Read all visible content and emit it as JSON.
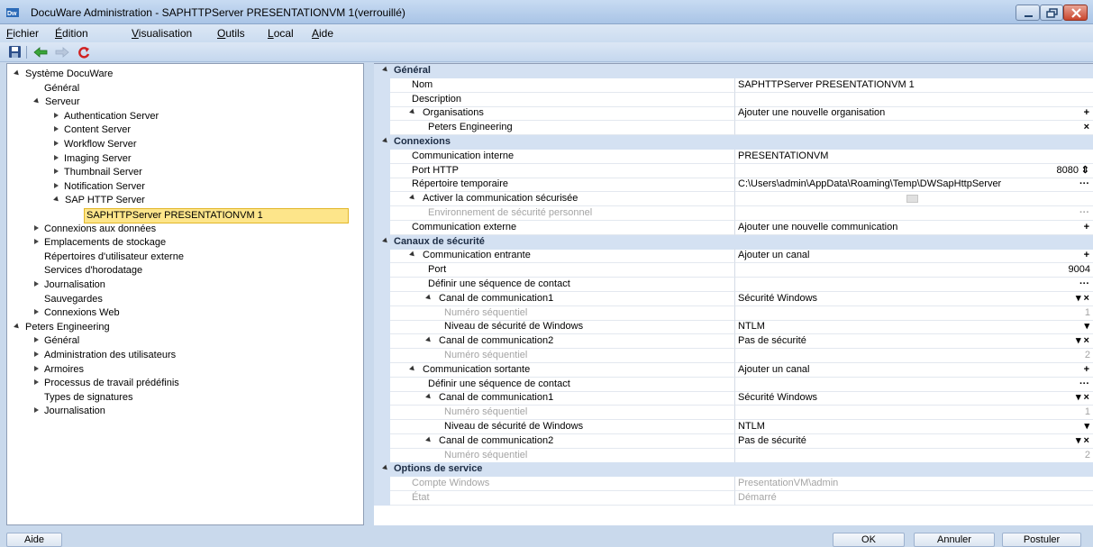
{
  "window": {
    "title": "DocuWare Administration - SAPHTTPServer PRESENTATIONVM 1(verrouillé)",
    "app_icon": "docuware-icon"
  },
  "menu": [
    {
      "accel": "F",
      "rest": "ichier"
    },
    {
      "accel": "É",
      "rest": "dition"
    },
    {
      "accel": "V",
      "rest": "isualisation"
    },
    {
      "accel": "O",
      "rest": "utils"
    },
    {
      "accel": "L",
      "rest": "ocal"
    },
    {
      "accel": "A",
      "rest": "ide"
    }
  ],
  "toolbar": [
    "save-icon",
    "back-arrow-icon",
    "forward-arrow-icon",
    "refresh-icon"
  ],
  "tree": [
    {
      "label": "Système DocuWare",
      "level": 0,
      "state": "open"
    },
    {
      "label": "Général",
      "level": 1,
      "state": "none"
    },
    {
      "label": "Serveur",
      "level": 1,
      "state": "open"
    },
    {
      "label": "Authentication Server",
      "level": 2,
      "state": "closed"
    },
    {
      "label": "Content Server",
      "level": 2,
      "state": "closed"
    },
    {
      "label": "Workflow Server",
      "level": 2,
      "state": "closed"
    },
    {
      "label": "Imaging Server",
      "level": 2,
      "state": "closed"
    },
    {
      "label": "Thumbnail Server",
      "level": 2,
      "state": "closed"
    },
    {
      "label": "Notification Server",
      "level": 2,
      "state": "closed"
    },
    {
      "label": "SAP HTTP Server",
      "level": 2,
      "state": "open"
    },
    {
      "label": "SAPHTTPServer PRESENTATIONVM 1",
      "level": 3,
      "state": "none",
      "selected": true
    },
    {
      "label": "Connexions aux données",
      "level": 1,
      "state": "closed"
    },
    {
      "label": "Emplacements de stockage",
      "level": 1,
      "state": "closed"
    },
    {
      "label": "Répertoires d'utilisateur externe",
      "level": 1,
      "state": "none"
    },
    {
      "label": "Services d'horodatage",
      "level": 1,
      "state": "none"
    },
    {
      "label": "Journalisation",
      "level": 1,
      "state": "closed"
    },
    {
      "label": "Sauvegardes",
      "level": 1,
      "state": "none"
    },
    {
      "label": "Connexions Web",
      "level": 1,
      "state": "closed"
    },
    {
      "label": "Peters Engineering",
      "level": 0,
      "state": "open"
    },
    {
      "label": "Général",
      "level": 1,
      "state": "closed"
    },
    {
      "label": "Administration des utilisateurs",
      "level": 1,
      "state": "closed"
    },
    {
      "label": "Armoires",
      "level": 1,
      "state": "closed"
    },
    {
      "label": "Processus de travail prédéfinis",
      "level": 1,
      "state": "closed"
    },
    {
      "label": "Types de signatures",
      "level": 1,
      "state": "none"
    },
    {
      "label": "Journalisation",
      "level": 1,
      "state": "closed"
    }
  ],
  "properties": [
    {
      "kind": "cat",
      "name": "Général"
    },
    {
      "name": "Nom",
      "value": "SAPHTTPServer PRESENTATIONVM 1",
      "level": 1
    },
    {
      "name": "Description",
      "value": "",
      "level": 1
    },
    {
      "name": "Organisations",
      "value": "Ajouter une nouvelle organisation",
      "level": 1,
      "expand": true,
      "action": "+"
    },
    {
      "name": "Peters Engineering",
      "value": "",
      "level": 2,
      "action": "×"
    },
    {
      "kind": "cat",
      "name": "Connexions"
    },
    {
      "name": "Communication interne",
      "value": "PRESENTATIONVM",
      "level": 1
    },
    {
      "name": "Port HTTP",
      "value": "8080",
      "level": 1,
      "align": "right",
      "action": "⇕"
    },
    {
      "name": "Répertoire temporaire",
      "value": "C:\\Users\\admin\\AppData\\Roaming\\Temp\\DWSapHttpServer",
      "level": 1,
      "action": "···"
    },
    {
      "name": "Activer la communication sécurisée",
      "value": "",
      "level": 1,
      "expand": true,
      "checkbox": true
    },
    {
      "name": "Environnement de sécurité personnel",
      "value": "",
      "level": 2,
      "disabled": true,
      "action": "···"
    },
    {
      "name": "Communication externe",
      "value": "Ajouter une nouvelle communication",
      "level": 1,
      "action": "+"
    },
    {
      "kind": "cat",
      "name": "Canaux de sécurité"
    },
    {
      "name": "Communication entrante",
      "value": "Ajouter un canal",
      "level": 1,
      "expand": true,
      "action": "+"
    },
    {
      "name": "Port",
      "value": "9004",
      "level": 2,
      "align": "right"
    },
    {
      "name": "Définir une séquence de contact",
      "value": "",
      "level": 2,
      "action": "···"
    },
    {
      "name": "Canal de communication1",
      "value": "Sécurité Windows",
      "level": 2,
      "expand": true,
      "action": "▾ ×"
    },
    {
      "name": "Numéro séquentiel",
      "value": "1",
      "level": 3,
      "disabled": true,
      "align": "right"
    },
    {
      "name": "Niveau de sécurité de Windows",
      "value": "NTLM",
      "level": 3,
      "action": "▾"
    },
    {
      "name": "Canal de communication2",
      "value": "Pas de sécurité",
      "level": 2,
      "expand": true,
      "action": "▾ ×"
    },
    {
      "name": "Numéro séquentiel",
      "value": "2",
      "level": 3,
      "disabled": true,
      "align": "right"
    },
    {
      "name": "Communication sortante",
      "value": "Ajouter un canal",
      "level": 1,
      "expand": true,
      "action": "+"
    },
    {
      "name": "Définir une séquence de contact",
      "value": "",
      "level": 2,
      "action": "···"
    },
    {
      "name": "Canal de communication1",
      "value": "Sécurité Windows",
      "level": 2,
      "expand": true,
      "action": "▾ ×"
    },
    {
      "name": "Numéro séquentiel",
      "value": "1",
      "level": 3,
      "disabled": true,
      "align": "right"
    },
    {
      "name": "Niveau de sécurité de Windows",
      "value": "NTLM",
      "level": 3,
      "action": "▾"
    },
    {
      "name": "Canal de communication2",
      "value": "Pas de sécurité",
      "level": 2,
      "expand": true,
      "action": "▾ ×"
    },
    {
      "name": "Numéro séquentiel",
      "value": "2",
      "level": 3,
      "disabled": true,
      "align": "right"
    },
    {
      "kind": "cat",
      "name": "Options de service"
    },
    {
      "name": "Compte Windows",
      "value": "PresentationVM\\admin",
      "level": 1,
      "disabled": true
    },
    {
      "name": "État",
      "value": "Démarré",
      "level": 1,
      "disabled": true
    }
  ],
  "buttons": {
    "help": "Aide",
    "ok": "OK",
    "cancel": "Annuler",
    "apply": "Postuler"
  },
  "colors": {
    "selection": "#fde58a",
    "category_bg": "#d4e1f2",
    "window_bg": "#c9d9ec"
  }
}
